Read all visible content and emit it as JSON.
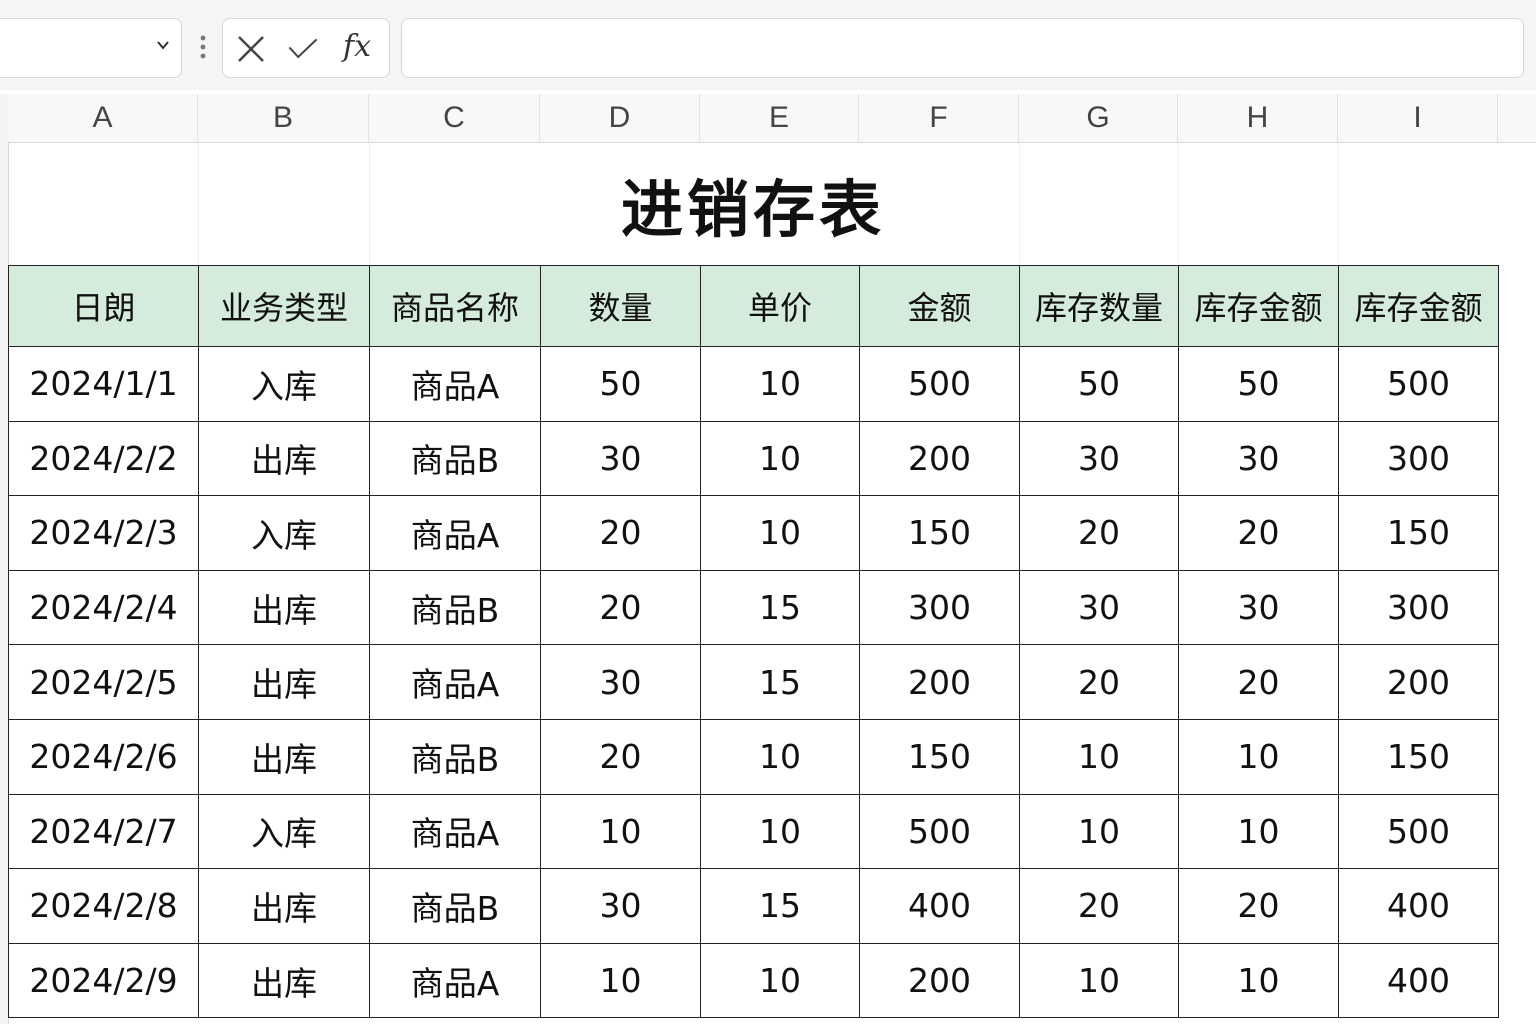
{
  "toolbar": {
    "name_box_value": "",
    "fx_label": "fx",
    "formula_value": "",
    "icons": [
      "chevron-down-icon",
      "more-vertical-icon",
      "cancel-icon",
      "confirm-icon",
      "function-icon"
    ]
  },
  "column_letters": [
    "A",
    "B",
    "C",
    "D",
    "E",
    "F",
    "G",
    "H",
    "I"
  ],
  "sheet": {
    "title": "进销存表",
    "header_color": "#d5ecdc",
    "headers": [
      "日朗",
      "业务类型",
      "商品名称",
      "数量",
      "单价",
      "金额",
      "库存数量",
      "库存金额",
      "库存金额"
    ],
    "rows": [
      [
        "2024/1/1",
        "入库",
        "商品A",
        "50",
        "10",
        "500",
        "50",
        "50",
        "500"
      ],
      [
        "2024/2/2",
        "出库",
        "商品B",
        "30",
        "10",
        "200",
        "30",
        "30",
        "300"
      ],
      [
        "2024/2/3",
        "入库",
        "商品A",
        "20",
        "10",
        "150",
        "20",
        "20",
        "150"
      ],
      [
        "2024/2/4",
        "出库",
        "商品B",
        "20",
        "15",
        "300",
        "30",
        "30",
        "300"
      ],
      [
        "2024/2/5",
        "出库",
        "商品A",
        "30",
        "15",
        "200",
        "20",
        "20",
        "200"
      ],
      [
        "2024/2/6",
        "出库",
        "商品B",
        "20",
        "10",
        "150",
        "10",
        "10",
        "150"
      ],
      [
        "2024/2/7",
        "入库",
        "商品A",
        "10",
        "10",
        "500",
        "10",
        "10",
        "500"
      ],
      [
        "2024/2/8",
        "出库",
        "商品B",
        "30",
        "15",
        "400",
        "20",
        "20",
        "400"
      ],
      [
        "2024/2/9",
        "出库",
        "商品A",
        "10",
        "10",
        "200",
        "10",
        "10",
        "400"
      ]
    ]
  }
}
